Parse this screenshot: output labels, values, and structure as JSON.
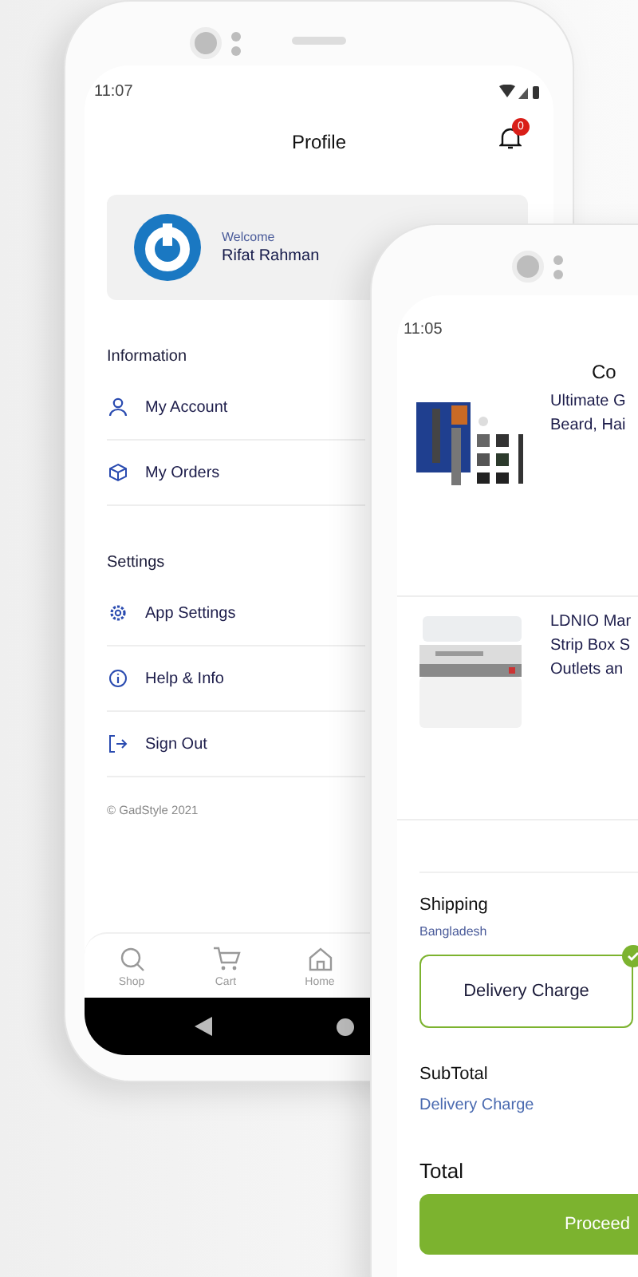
{
  "profile_screen": {
    "status_time": "11:07",
    "title": "Profile",
    "notification_count": "0",
    "welcome": {
      "greeting": "Welcome",
      "name": "Rifat Rahman"
    },
    "sections": [
      {
        "heading": "Information",
        "items": [
          {
            "label": "My Account"
          },
          {
            "label": "My Orders"
          }
        ]
      },
      {
        "heading": "Settings",
        "items": [
          {
            "label": "App Settings"
          },
          {
            "label": "Help & Info"
          },
          {
            "label": "Sign Out"
          }
        ]
      }
    ],
    "footer": "© GadStyle 2021",
    "bottom_nav": [
      {
        "label": "Shop"
      },
      {
        "label": "Cart"
      },
      {
        "label": "Home"
      }
    ]
  },
  "cart_screen": {
    "status_time": "11:05",
    "title": "Co",
    "products": [
      {
        "title": "Ultimate G\nBeard, Hai",
        "kind": "picture"
      },
      {
        "title": "LDNIO Mar\nStrip Box S\nOutlets an",
        "kind": "picture"
      }
    ],
    "shipping": {
      "label": "Shipping",
      "country": "Bangladesh",
      "options": [
        {
          "label": "Delivery Charge",
          "selected": true
        }
      ]
    },
    "subtotal": {
      "label": "SubTotal",
      "value": "Delivery Charge"
    },
    "total_label": "Total",
    "proceed_button": "Proceed"
  }
}
